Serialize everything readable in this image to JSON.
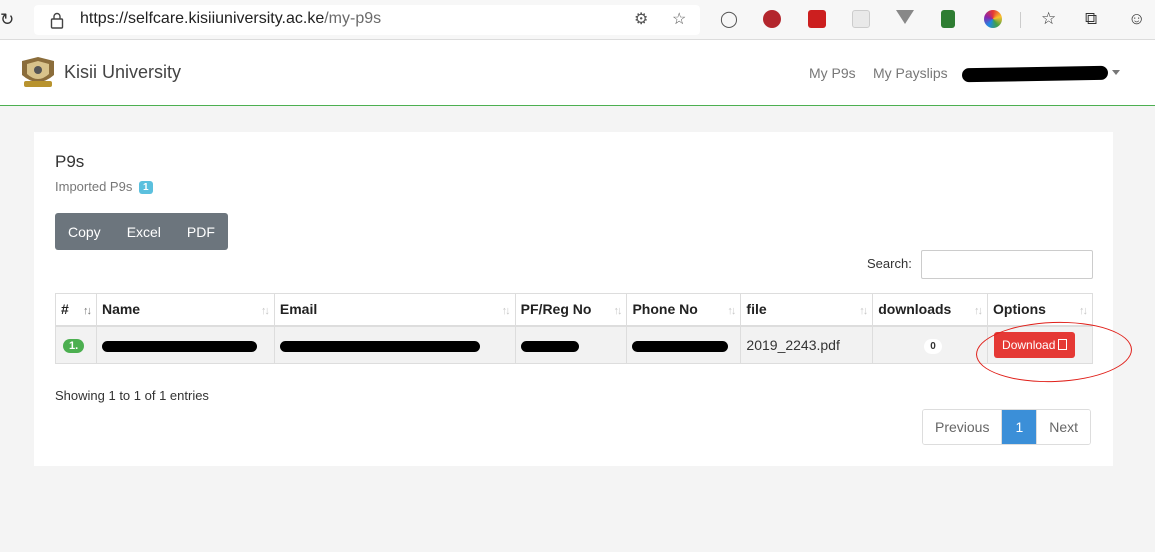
{
  "browser": {
    "url_host": "https://selfcare.kisiiuniversity.ac.ke",
    "url_path": "/my-p9s"
  },
  "site": {
    "brand": "Kisii University",
    "nav": [
      "My P9s",
      "My Payslips"
    ]
  },
  "card": {
    "title": "P9s",
    "subtitle": "Imported P9s",
    "count": "1",
    "export_buttons": [
      "Copy",
      "Excel",
      "PDF"
    ],
    "search_label": "Search:",
    "search_value": ""
  },
  "table": {
    "columns": [
      "#",
      "Name",
      "Email",
      "PF/Reg No",
      "Phone No",
      "file",
      "downloads",
      "Options"
    ],
    "rows": [
      {
        "index": "1.",
        "file": "2019_2243.pdf",
        "downloads": "0",
        "action": "Download"
      }
    ]
  },
  "footer": {
    "info": "Showing 1 to 1 of 1 entries",
    "pager": [
      "Previous",
      "1",
      "Next"
    ]
  },
  "colors": {
    "accent_green": "#4caf50",
    "download_red": "#e53935",
    "pager_active": "#3b8fd8",
    "export_gray": "#6c757d"
  },
  "icons": [
    "reload-icon",
    "lock-icon",
    "star-icon",
    "favorites-icon",
    "collections-icon",
    "profile-icon",
    "pdf-icon"
  ]
}
